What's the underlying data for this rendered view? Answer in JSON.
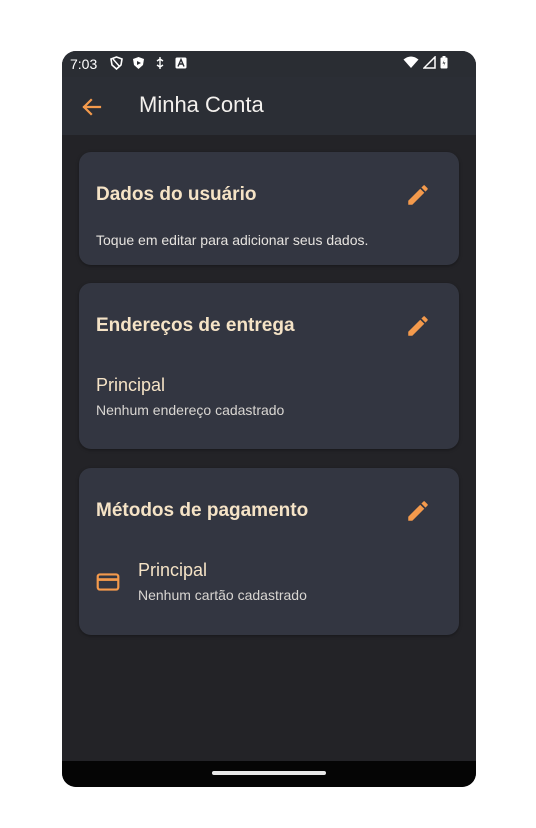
{
  "status_bar": {
    "time": "7:03"
  },
  "app_bar": {
    "title": "Minha Conta"
  },
  "cards": {
    "user": {
      "title": "Dados do usuário",
      "hint": "Toque em editar para adicionar seus dados."
    },
    "address": {
      "title": "Endereços de entrega",
      "item_title": "Principal",
      "item_subtitle": "Nenhum endereço cadastrado"
    },
    "payment": {
      "title": "Métodos de pagamento",
      "item_title": "Principal",
      "item_subtitle": "Nenhum cartão cadastrado"
    }
  },
  "icons": {
    "back": "arrow-back-icon",
    "edit": "pencil-icon",
    "card": "credit-card-icon"
  },
  "colors": {
    "accent": "#f49a4c",
    "card_title": "#f5e3c6",
    "background": "#232327",
    "card_bg": "#333641"
  }
}
